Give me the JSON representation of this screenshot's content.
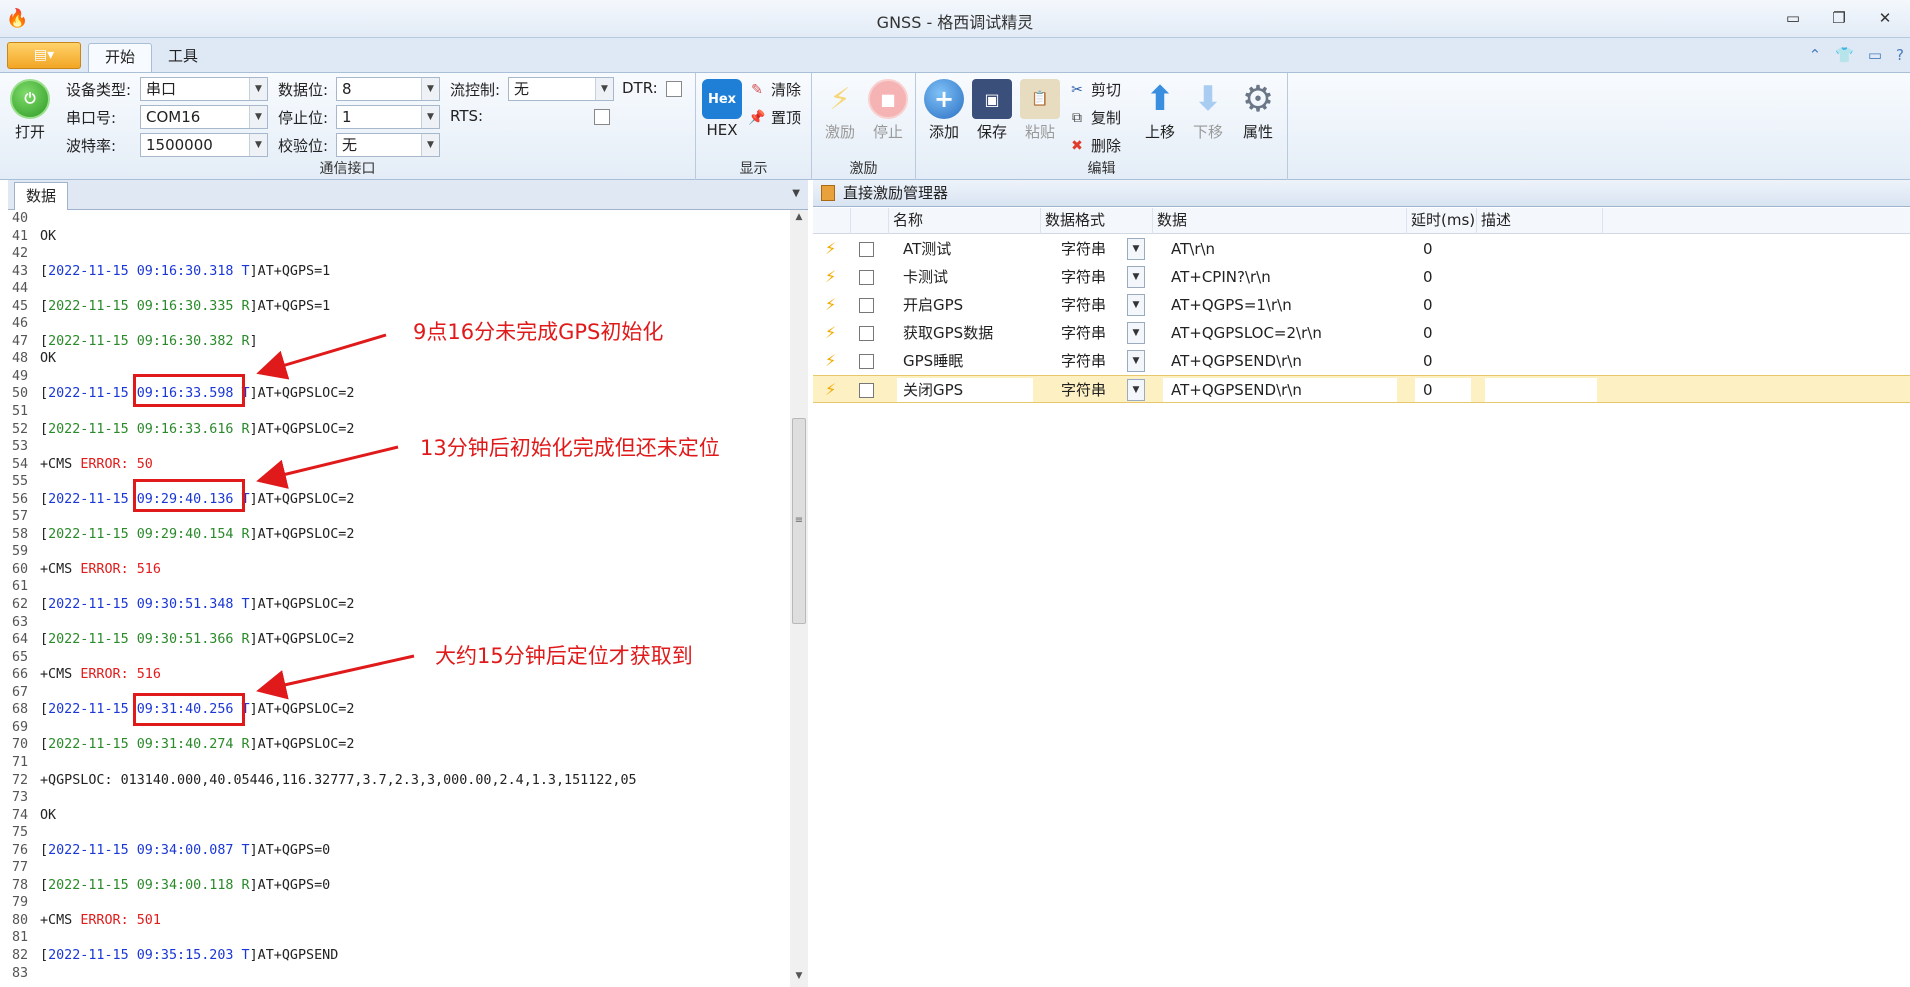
{
  "window": {
    "title": "GNSS - 格西调试精灵"
  },
  "tabs": [
    {
      "label": "开始"
    },
    {
      "label": "工具"
    }
  ],
  "ribbon": {
    "open_label": "打开",
    "device_type": {
      "label": "设备类型:",
      "value": "串口"
    },
    "port": {
      "label": "串口号:",
      "value": "COM16"
    },
    "baud": {
      "label": "波特率:",
      "value": "1500000"
    },
    "data_bits": {
      "label": "数据位:",
      "value": "8"
    },
    "stop_bits": {
      "label": "停止位:",
      "value": "1"
    },
    "parity": {
      "label": "校验位:",
      "value": "无"
    },
    "flow_control": {
      "label": "流控制:",
      "value": "无"
    },
    "dtr_label": "DTR:",
    "rts_label": "RTS:",
    "comm_group": "通信接口",
    "hex_icon": "Hex",
    "hex_label": "HEX",
    "clear_label": "清除",
    "top_label": "置顶",
    "display_group": "显示",
    "stim_label": "激励",
    "stop_label": "停止",
    "stim_group": "激励",
    "add_label": "添加",
    "save_label": "保存",
    "paste_label": "粘贴",
    "cut_label": "剪切",
    "copy_label": "复制",
    "delete_label": "删除",
    "up_label": "上移",
    "down_label": "下移",
    "props_label": "属性",
    "edit_group": "编辑"
  },
  "left_pane": {
    "tab": "数据",
    "lines": [
      {
        "n": "40",
        "parts": []
      },
      {
        "n": "41",
        "parts": [
          {
            "t": "OK",
            "c": ""
          }
        ]
      },
      {
        "n": "42",
        "parts": []
      },
      {
        "n": "43",
        "parts": [
          {
            "t": "[",
            "c": ""
          },
          {
            "t": "2022-11-15 09:16:30.318 T",
            "c": "b"
          },
          {
            "t": "]AT+QGPS=1",
            "c": ""
          }
        ]
      },
      {
        "n": "44",
        "parts": []
      },
      {
        "n": "45",
        "parts": [
          {
            "t": "[",
            "c": ""
          },
          {
            "t": "2022-11-15 09:16:30.335 R",
            "c": "g"
          },
          {
            "t": "]AT+QGPS=1",
            "c": ""
          }
        ]
      },
      {
        "n": "46",
        "parts": []
      },
      {
        "n": "47",
        "parts": [
          {
            "t": "[",
            "c": ""
          },
          {
            "t": "2022-11-15 09:16:30.382 R",
            "c": "g"
          },
          {
            "t": "]",
            "c": ""
          }
        ]
      },
      {
        "n": "48",
        "parts": [
          {
            "t": "OK",
            "c": ""
          }
        ]
      },
      {
        "n": "49",
        "parts": []
      },
      {
        "n": "50",
        "parts": [
          {
            "t": "[",
            "c": ""
          },
          {
            "t": "2022-11-15 09:16:33.598 T",
            "c": "b"
          },
          {
            "t": "]AT+QGPSLOC=2",
            "c": ""
          }
        ]
      },
      {
        "n": "51",
        "parts": []
      },
      {
        "n": "52",
        "parts": [
          {
            "t": "[",
            "c": ""
          },
          {
            "t": "2022-11-15 09:16:33.616 R",
            "c": "g"
          },
          {
            "t": "]AT+QGPSLOC=2",
            "c": ""
          }
        ]
      },
      {
        "n": "53",
        "parts": []
      },
      {
        "n": "54",
        "parts": [
          {
            "t": "+CMS ",
            "c": ""
          },
          {
            "t": "ERROR: 50",
            "c": "r"
          }
        ]
      },
      {
        "n": "55",
        "parts": []
      },
      {
        "n": "56",
        "parts": [
          {
            "t": "[",
            "c": ""
          },
          {
            "t": "2022-11-15 09:29:40.136 T",
            "c": "b"
          },
          {
            "t": "]AT+QGPSLOC=2",
            "c": ""
          }
        ]
      },
      {
        "n": "57",
        "parts": []
      },
      {
        "n": "58",
        "parts": [
          {
            "t": "[",
            "c": ""
          },
          {
            "t": "2022-11-15 09:29:40.154 R",
            "c": "g"
          },
          {
            "t": "]AT+QGPSLOC=2",
            "c": ""
          }
        ]
      },
      {
        "n": "59",
        "parts": []
      },
      {
        "n": "60",
        "parts": [
          {
            "t": "+CMS ",
            "c": ""
          },
          {
            "t": "ERROR: 516",
            "c": "r"
          }
        ]
      },
      {
        "n": "61",
        "parts": []
      },
      {
        "n": "62",
        "parts": [
          {
            "t": "[",
            "c": ""
          },
          {
            "t": "2022-11-15 09:30:51.348 T",
            "c": "b"
          },
          {
            "t": "]AT+QGPSLOC=2",
            "c": ""
          }
        ]
      },
      {
        "n": "63",
        "parts": []
      },
      {
        "n": "64",
        "parts": [
          {
            "t": "[",
            "c": ""
          },
          {
            "t": "2022-11-15 09:30:51.366 R",
            "c": "g"
          },
          {
            "t": "]AT+QGPSLOC=2",
            "c": ""
          }
        ]
      },
      {
        "n": "65",
        "parts": []
      },
      {
        "n": "66",
        "parts": [
          {
            "t": "+CMS ",
            "c": ""
          },
          {
            "t": "ERROR: 516",
            "c": "r"
          }
        ]
      },
      {
        "n": "67",
        "parts": []
      },
      {
        "n": "68",
        "parts": [
          {
            "t": "[",
            "c": ""
          },
          {
            "t": "2022-11-15 09:31:40.256 T",
            "c": "b"
          },
          {
            "t": "]AT+QGPSLOC=2",
            "c": ""
          }
        ]
      },
      {
        "n": "69",
        "parts": []
      },
      {
        "n": "70",
        "parts": [
          {
            "t": "[",
            "c": ""
          },
          {
            "t": "2022-11-15 09:31:40.274 R",
            "c": "g"
          },
          {
            "t": "]AT+QGPSLOC=2",
            "c": ""
          }
        ]
      },
      {
        "n": "71",
        "parts": []
      },
      {
        "n": "72",
        "parts": [
          {
            "t": "+QGPSLOC: 013140.000,40.05446,116.32777,3.7,2.3,3,000.00,2.4,1.3,151122,05",
            "c": ""
          }
        ]
      },
      {
        "n": "73",
        "parts": []
      },
      {
        "n": "74",
        "parts": [
          {
            "t": "OK",
            "c": ""
          }
        ]
      },
      {
        "n": "75",
        "parts": []
      },
      {
        "n": "76",
        "parts": [
          {
            "t": "[",
            "c": ""
          },
          {
            "t": "2022-11-15 09:34:00.087 T",
            "c": "b"
          },
          {
            "t": "]AT+QGPS=0",
            "c": ""
          }
        ]
      },
      {
        "n": "77",
        "parts": []
      },
      {
        "n": "78",
        "parts": [
          {
            "t": "[",
            "c": ""
          },
          {
            "t": "2022-11-15 09:34:00.118 R",
            "c": "g"
          },
          {
            "t": "]AT+QGPS=0",
            "c": ""
          }
        ]
      },
      {
        "n": "79",
        "parts": []
      },
      {
        "n": "80",
        "parts": [
          {
            "t": "+CMS ",
            "c": ""
          },
          {
            "t": "ERROR: 501",
            "c": "r"
          }
        ]
      },
      {
        "n": "81",
        "parts": []
      },
      {
        "n": "82",
        "parts": [
          {
            "t": "[",
            "c": ""
          },
          {
            "t": "2022-11-15 09:35:15.203 T",
            "c": "b"
          },
          {
            "t": "]AT+QGPSEND",
            "c": ""
          }
        ]
      },
      {
        "n": "83",
        "parts": []
      }
    ]
  },
  "annotations": [
    "9点16分未完成GPS初始化",
    "13分钟后初始化完成但还未定位",
    "大约15分钟后定位才获取到"
  ],
  "right_pane": {
    "title": "直接激励管理器",
    "columns": [
      "名称",
      "数据格式",
      "数据",
      "延时(ms)",
      "描述"
    ],
    "rows": [
      {
        "name": "AT测试",
        "format": "字符串",
        "data": "AT\\r\\n",
        "delay": "0"
      },
      {
        "name": "卡测试",
        "format": "字符串",
        "data": "AT+CPIN?\\r\\n",
        "delay": "0"
      },
      {
        "name": "开启GPS",
        "format": "字符串",
        "data": "AT+QGPS=1\\r\\n",
        "delay": "0"
      },
      {
        "name": "获取GPS数据",
        "format": "字符串",
        "data": "AT+QGPSLOC=2\\r\\n",
        "delay": "0"
      },
      {
        "name": "GPS睡眠",
        "format": "字符串",
        "data": "AT+QGPSEND\\r\\n",
        "delay": "0"
      },
      {
        "name": "关闭GPS",
        "format": "字符串",
        "data": "AT+QGPSEND\\r\\n",
        "delay": "0"
      }
    ]
  },
  "colors": {
    "timestamp_sent": "#1a37d6",
    "timestamp_recv": "#2a8a2a",
    "error": "#e21b1b",
    "annotation": "#e01a1a"
  }
}
